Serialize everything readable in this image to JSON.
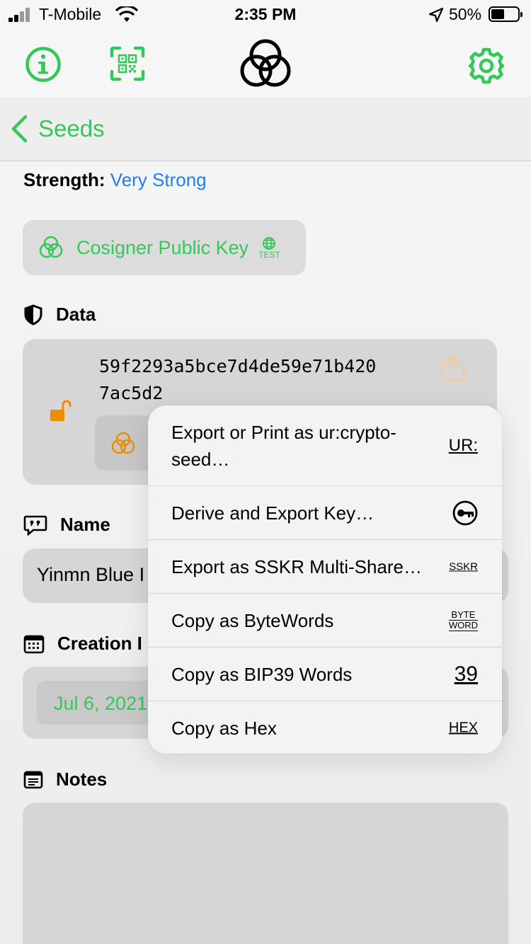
{
  "status": {
    "carrier": "T-Mobile",
    "time": "2:35 PM",
    "battery": "50%"
  },
  "nav": {
    "back_label": "Seeds"
  },
  "seed": {
    "strength_label": "Strength:",
    "strength_value": "Very Strong",
    "cosigner_label": "Cosigner Public Key",
    "test_badge": "TEST"
  },
  "data_section": {
    "title": "Data",
    "hex_line1": "59f2293a5bce7d4de59e71b420",
    "hex_line2": "7ac5d2"
  },
  "name_section": {
    "title": "Name",
    "value": "Yinmn Blue I"
  },
  "creation_section": {
    "title": "Creation I",
    "value": "Jul 6, 2021"
  },
  "notes_section": {
    "title": "Notes"
  },
  "menu": {
    "items": [
      {
        "label": "Export or Print as ur:crypto-seed…",
        "icon_text": "UR:",
        "icon": "ur-icon"
      },
      {
        "label": "Derive and Export Key…",
        "icon": "key-icon"
      },
      {
        "label": "Export as SSKR Multi-Share…",
        "icon_text": "SSKR",
        "icon": "sskr-icon"
      },
      {
        "label": "Copy as ByteWords",
        "icon_text_1": "BYTE",
        "icon_text_2": "WORD",
        "icon": "bytewords-icon"
      },
      {
        "label": "Copy as BIP39 Words",
        "icon_text": "39",
        "icon": "bip39-icon"
      },
      {
        "label": "Copy as Hex",
        "icon_text": "HEX",
        "icon": "hex-icon"
      }
    ]
  },
  "colors": {
    "accent": "#34c759",
    "link": "#1f7ff0",
    "lock": "#f08c00"
  }
}
